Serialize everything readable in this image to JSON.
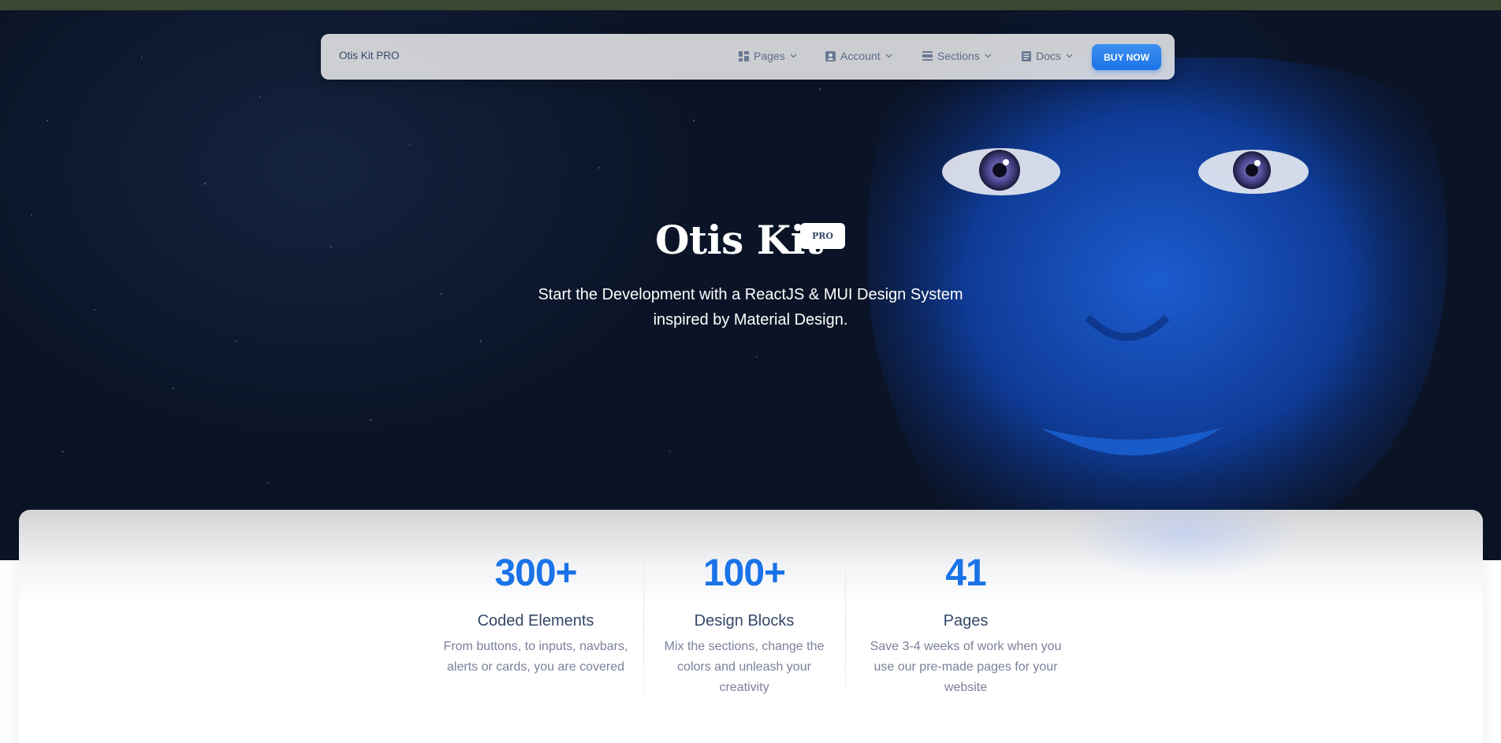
{
  "navbar": {
    "brand": "Otis Kit PRO",
    "items": [
      {
        "label": "Pages",
        "icon": "dashboard-icon"
      },
      {
        "label": "Account",
        "icon": "account-icon"
      },
      {
        "label": "Sections",
        "icon": "view-day-icon"
      },
      {
        "label": "Docs",
        "icon": "article-icon"
      }
    ],
    "cta": "BUY NOW"
  },
  "hero": {
    "title": "Otis Kit",
    "badge": "PRO",
    "subtitle_line1": "Start the Development with a ReactJS & MUI Design System",
    "subtitle_line2": "inspired by Material Design."
  },
  "stats": [
    {
      "value": "300+",
      "title": "Coded Elements",
      "desc_lines": [
        "From buttons, to inputs, navbars,",
        "alerts or cards, you are covered"
      ]
    },
    {
      "value": "100+",
      "title": "Design Blocks",
      "desc_lines": [
        "Mix the sections, change the",
        "colors and unleash your",
        "creativity"
      ]
    },
    {
      "value": "41",
      "title": "Pages",
      "desc_lines": [
        "Save 3-4 weeks of work when you",
        "use our pre-made pages for your",
        "website"
      ]
    }
  ],
  "colors": {
    "accent": "#1a73e8",
    "text_dark": "#344767",
    "text_muted": "#7b809a",
    "topbar": "#3a4731"
  }
}
